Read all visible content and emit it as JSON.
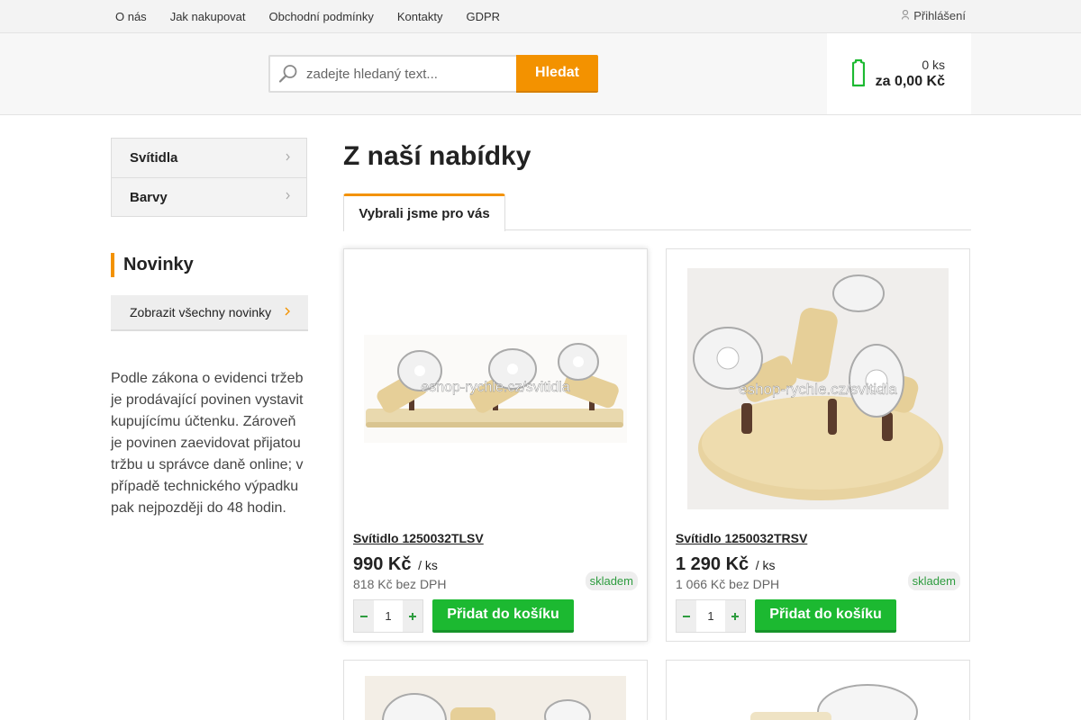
{
  "topnav": {
    "links": [
      "O nás",
      "Jak nakupovat",
      "Obchodní podmínky",
      "Kontakty",
      "GDPR"
    ],
    "login_label": "Přihlášení"
  },
  "search": {
    "placeholder": "zadejte hledaný text...",
    "button_label": "Hledat"
  },
  "cart": {
    "count": "0 ks",
    "total": "za 0,00 Kč"
  },
  "sidebar": {
    "categories": [
      "Svítidla",
      "Barvy"
    ],
    "news_heading": "Novinky",
    "news_button": "Zobrazit všechny novinky",
    "law_text": "Podle zákona o evidenci tržeb je prodávající povinen vystavit kupujícímu účtenku. Zároveň je povinen zaevidovat přijatou tržbu u správce daně online; v případě technického výpadku pak nejpozději do 48 hodin."
  },
  "main": {
    "title": "Z naší nabídky",
    "tab": "Vybrali jsme pro vás"
  },
  "products": [
    {
      "name": "Svítidlo 1250032TLSV",
      "price": "990 Kč",
      "unit": "/ ks",
      "price_vat": "818 Kč bez DPH",
      "stock": "skladem",
      "qty": "1",
      "add_label": "Přidat do košíku",
      "watermark": "eshop-rychle.cz/svitidla"
    },
    {
      "name": "Svítidlo 1250032TRSV",
      "price": "1 290 Kč",
      "unit": "/ ks",
      "price_vat": "1 066 Kč bez DPH",
      "stock": "skladem",
      "qty": "1",
      "add_label": "Přidat do košíku",
      "watermark": "eshop-rychle.cz/svitidla"
    }
  ],
  "colors": {
    "accent": "#f39200",
    "green": "#1cb931",
    "stock_green": "#2e9c3f"
  }
}
